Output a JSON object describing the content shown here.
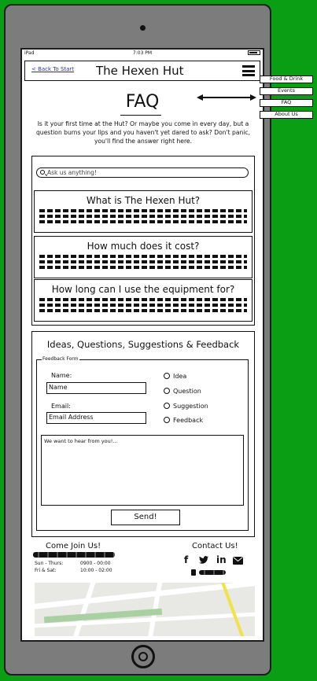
{
  "status_bar": {
    "device": "iPad",
    "time": "7:03 PM"
  },
  "header": {
    "back_link": "< Back To Start",
    "brand": "The Hexen Hut"
  },
  "faq": {
    "title": "FAQ",
    "intro": "Is it your first time at the Hut? Or maybe you come in every day, but a question burns your lips and you haven't yet dared to ask? Don't panic, you'll find the answer right here.",
    "search_placeholder": "Ask us anything!",
    "questions": [
      "What is The Hexen Hut?",
      "How much does it cost?",
      "How long can I use the equipment for?"
    ]
  },
  "feedback": {
    "title": "Ideas, Questions, Suggestions & Feedback",
    "legend": "Feedback Form",
    "name_label": "Name:",
    "name_value": "Name",
    "email_label": "Email:",
    "email_value": "Email Address",
    "options": [
      "Idea",
      "Question",
      "Suggestion",
      "Feedback"
    ],
    "message_placeholder": "We want to hear from you!...",
    "send_label": "Send!"
  },
  "footer": {
    "join_title": "Come Join Us!",
    "hours": [
      {
        "days": "Sun - Thurs:",
        "time": "0900 - 00:00"
      },
      {
        "days": "Fri & Sat:",
        "time": "10:00 - 02:00"
      }
    ],
    "contact_title": "Contact Us!",
    "socials": {
      "facebook": "f",
      "linkedin": "in"
    }
  },
  "side_menu": [
    "Food & Drink",
    "Events",
    "FAQ",
    "About Us"
  ],
  "icons": [
    "menu-icon",
    "search-icon",
    "twitter-icon",
    "mail-icon",
    "phone-icon",
    "home-button-icon"
  ]
}
